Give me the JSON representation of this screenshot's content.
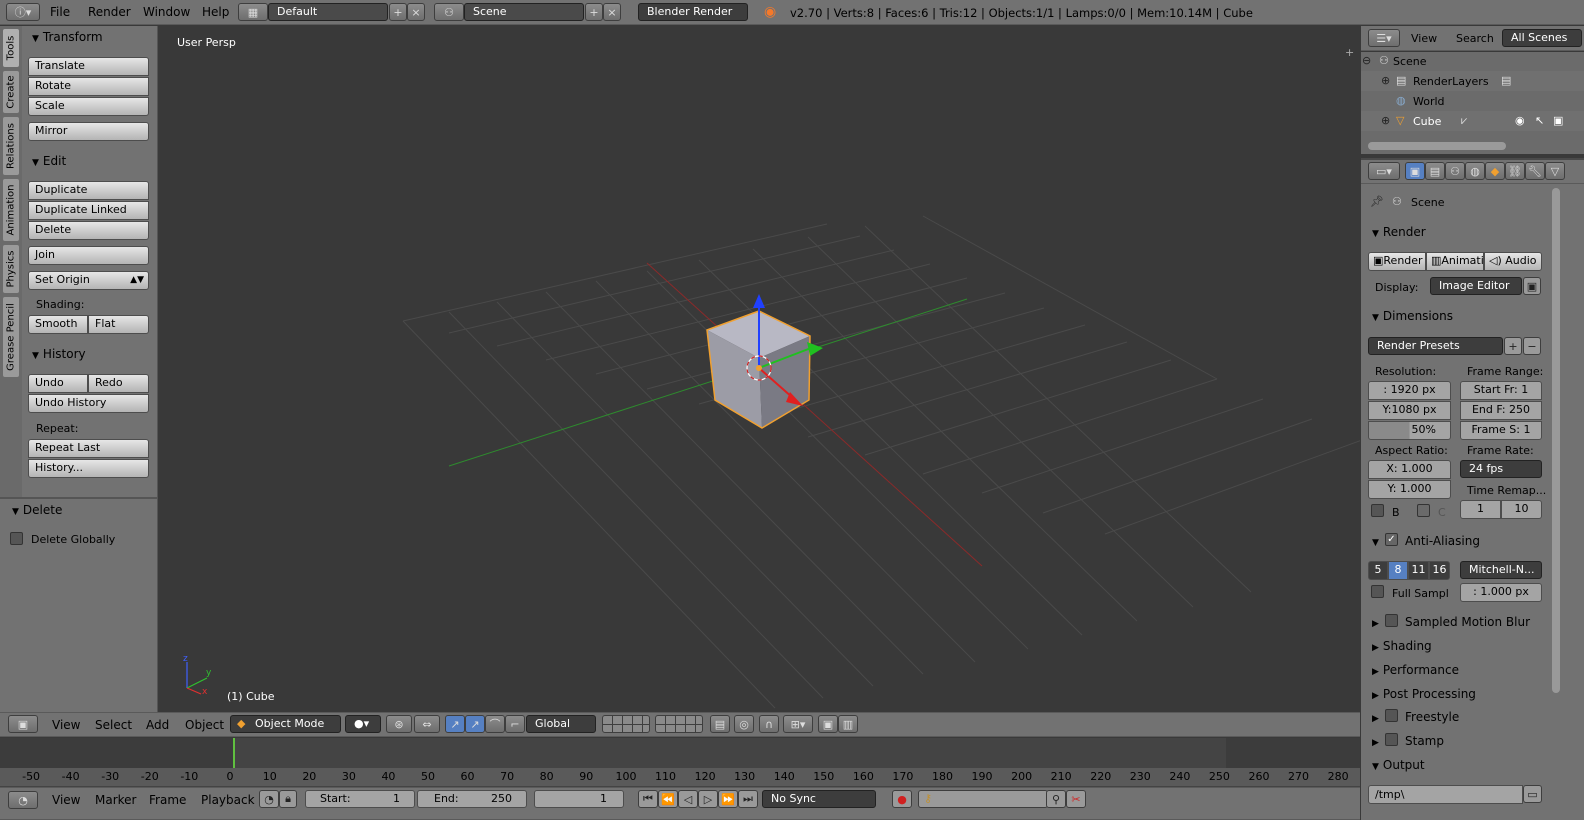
{
  "topbar": {
    "menus": [
      "File",
      "Render",
      "Window",
      "Help"
    ],
    "layout": "Default",
    "scene": "Scene",
    "engine": "Blender Render",
    "stats": "v2.70 | Verts:8 | Faces:6 | Tris:12 | Objects:1/1 | Lamps:0/0 | Mem:10.14M | Cube"
  },
  "toolshelf": {
    "tabs": [
      "Tools",
      "Create",
      "Relations",
      "Animation",
      "Physics",
      "Grease Pencil"
    ],
    "transform": {
      "title": "Transform",
      "buttons": [
        "Translate",
        "Rotate",
        "Scale",
        "Mirror"
      ]
    },
    "edit": {
      "title": "Edit",
      "duplicate": "Duplicate",
      "duplicate_linked": "Duplicate Linked",
      "delete": "Delete",
      "join": "Join",
      "set_origin": "Set Origin",
      "shading_label": "Shading:",
      "smooth": "Smooth",
      "flat": "Flat"
    },
    "history": {
      "title": "History",
      "undo": "Undo",
      "redo": "Redo",
      "undo_history": "Undo History",
      "repeat_label": "Repeat:",
      "repeat_last": "Repeat Last",
      "history": "History..."
    },
    "operator": {
      "title": "Delete",
      "checkbox": "Delete Globally"
    }
  },
  "viewport": {
    "view_name": "User Persp",
    "object_label": "(1) Cube"
  },
  "view3d_header": {
    "menus": [
      "View",
      "Select",
      "Add",
      "Object"
    ],
    "mode": "Object Mode",
    "orientation": "Global"
  },
  "outliner": {
    "menus": [
      "View",
      "Search"
    ],
    "filter": "All Scenes",
    "items": [
      "Scene",
      "RenderLayers",
      "World",
      "Cube"
    ]
  },
  "properties": {
    "context_scene": "Scene",
    "render": {
      "title": "Render",
      "render_btn": "Render",
      "anim_btn": "Animati",
      "audio_btn": "Audio",
      "display_label": "Display:",
      "display_value": "Image Editor"
    },
    "dimensions": {
      "title": "Dimensions",
      "presets": "Render Presets",
      "resolution_label": "Resolution:",
      "res_x": ": 1920 px",
      "res_y": "Y:1080 px",
      "res_pct": "50%",
      "frame_range_label": "Frame Range:",
      "start": "Start Fr:  1",
      "end": "End F: 250",
      "step": "Frame S: 1",
      "aspect_label": "Aspect Ratio:",
      "asp_x": "X:   1.000",
      "asp_y": "Y:   1.000",
      "frame_rate_label": "Frame Rate:",
      "fps": "24 fps",
      "time_remap_label": "Time Remap...",
      "remap_old": "1",
      "remap_new": "10",
      "border_b": "B",
      "border_c": "C"
    },
    "aa": {
      "title": "Anti-Aliasing",
      "samples": [
        "5",
        "8",
        "11",
        "16"
      ],
      "filter": "Mitchell-N...",
      "full_sample": "Full Sampl",
      "size": ": 1.000 px"
    },
    "collapsed_panels": [
      "Sampled Motion Blur",
      "Shading",
      "Performance",
      "Post Processing",
      "Freestyle",
      "Stamp"
    ],
    "output": {
      "title": "Output",
      "path": "/tmp\\"
    }
  },
  "timeline": {
    "ticks": [
      "-50",
      "-40",
      "-30",
      "-20",
      "-10",
      "0",
      "10",
      "20",
      "30",
      "40",
      "50",
      "60",
      "70",
      "80",
      "90",
      "100",
      "110",
      "120",
      "130",
      "140",
      "150",
      "160",
      "170",
      "180",
      "190",
      "200",
      "210",
      "220",
      "230",
      "240",
      "250",
      "260",
      "270",
      "280"
    ],
    "menus": [
      "View",
      "Marker",
      "Frame",
      "Playback"
    ],
    "start": "Start:",
    "start_val": "1",
    "end": "End:",
    "end_val": "250",
    "current": "1",
    "sync": "No Sync"
  }
}
